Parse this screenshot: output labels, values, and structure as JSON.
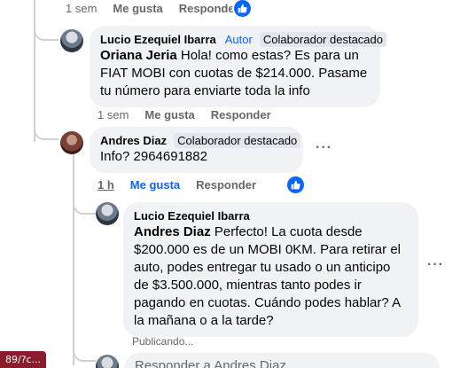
{
  "top_actions": {
    "time": "1 sem",
    "like": "Me gusta",
    "reply": "Responder"
  },
  "comment_lucio_1": {
    "author": "Lucio Ezequiel Ibarra",
    "author_tag": "Autor",
    "badge": "Colaborador destacado",
    "mention": "Oriana Jeria",
    "text": " Hola! como estas? Es para un FIAT MOBI con cuotas de $214.000. Pasame tu número para enviarte toda la info",
    "time": "1 sem",
    "like": "Me gusta",
    "reply": "Responder"
  },
  "comment_andres": {
    "author": "Andres Diaz",
    "badge": "Colaborador destacado",
    "text": "Info? 2964691882",
    "time": "1 h",
    "like": "Me gusta",
    "reply": "Responder"
  },
  "comment_lucio_2": {
    "author": "Lucio Ezequiel Ibarra",
    "mention": "Andres Diaz",
    "text": " Perfecto! La cuota desde $200.000 es de un MOBI 0KM. Para retirar el auto, podes entregar tu usado o un anticipo de $3.500.000, mientras tanto podes ir pagando en cuotas. Cuándo podes hablar? A la mañana o a la tarde?",
    "status": "Publicando..."
  },
  "reply_input": {
    "placeholder": "Responder a Andres Diaz"
  },
  "url_fragment": "89/?c...",
  "icons": {
    "like_badge": "thumbs-up-icon",
    "more": "more-options-icon"
  },
  "colors": {
    "accent": "#0866ff",
    "bubble": "#f0f2f5",
    "muted": "#65676b"
  }
}
